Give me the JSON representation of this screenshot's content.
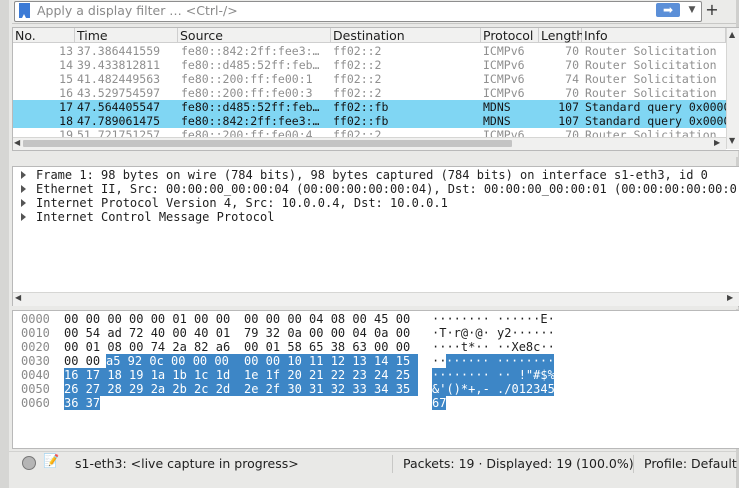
{
  "filter_bar": {
    "placeholder": "Apply a display filter … <Ctrl-/>",
    "apply_icon": "arrow-right-icon",
    "dropdown_icon": "chevron-down-icon",
    "add_button": "+"
  },
  "packet_list": {
    "columns": [
      "No.",
      "Time",
      "Source",
      "Destination",
      "Protocol",
      "Length",
      "Info"
    ],
    "rows": [
      {
        "no": "13",
        "time": "37.386441559",
        "source": "fe80::842:2ff:fee3:…",
        "destination": "ff02::2",
        "protocol": "ICMPv6",
        "length": "70",
        "info": "Router Solicitation",
        "selected": false
      },
      {
        "no": "14",
        "time": "39.433812811",
        "source": "fe80::d485:52ff:feb…",
        "destination": "ff02::2",
        "protocol": "ICMPv6",
        "length": "70",
        "info": "Router Solicitation",
        "selected": false
      },
      {
        "no": "15",
        "time": "41.482449563",
        "source": "fe80::200:ff:fe00:1",
        "destination": "ff02::2",
        "protocol": "ICMPv6",
        "length": "74",
        "info": "Router Solicitation",
        "selected": false
      },
      {
        "no": "16",
        "time": "43.529754597",
        "source": "fe80::200:ff:fe00:3",
        "destination": "ff02::2",
        "protocol": "ICMPv6",
        "length": "70",
        "info": "Router Solicitation",
        "selected": false
      },
      {
        "no": "17",
        "time": "47.564405547",
        "source": "fe80::d485:52ff:feb…",
        "destination": "ff02::fb",
        "protocol": "MDNS",
        "length": "107",
        "info": "Standard query 0x0000",
        "selected": true
      },
      {
        "no": "18",
        "time": "47.789061475",
        "source": "fe80::842:2ff:fee3:…",
        "destination": "ff02::fb",
        "protocol": "MDNS",
        "length": "107",
        "info": "Standard query 0x0000",
        "selected": true
      },
      {
        "no": "19",
        "time": "51.721751257",
        "source": "fe80::200:ff:fe00:4",
        "destination": "ff02::2",
        "protocol": "ICMPv6",
        "length": "70",
        "info": "Router Solicitation",
        "selected": false
      }
    ]
  },
  "details": {
    "lines": [
      "Frame 1: 98 bytes on wire (784 bits), 98 bytes captured (784 bits) on interface s1-eth3, id 0",
      "Ethernet II, Src: 00:00:00_00:00:04 (00:00:00:00:00:04), Dst: 00:00:00_00:00:01 (00:00:00:00:00:01)",
      "Internet Protocol Version 4, Src: 10.0.0.4, Dst: 10.0.0.1",
      "Internet Control Message Protocol"
    ]
  },
  "bytes": {
    "rows": [
      {
        "offset": "0000",
        "hex1": "00 00 00 00 00 01 00 00",
        "hex2": "00 00 00 04 08 00 45 00",
        "ascii": "········ ······E·"
      },
      {
        "offset": "0010",
        "hex1": "00 54 ad 72 40 00 40 01",
        "hex2": "79 32 0a 00 00 04 0a 00",
        "ascii": "·T·r@·@· y2······"
      },
      {
        "offset": "0020",
        "hex1": "00 01 08 00 74 2a 82 a6",
        "hex2": "00 01 58 65 38 63 00 00",
        "ascii": "····t*·· ··Xe8c··"
      },
      {
        "offset": "0030",
        "hex1_plain": "00 00",
        "hex1_hl": "a5 92 0c 00 00 00",
        "hex2": "00 00 10 11 12 13 14 15",
        "ascii_plain": "··",
        "ascii_hl": "······ ········"
      },
      {
        "offset": "0040",
        "hex1": "16 17 18 19 1a 1b 1c 1d",
        "hex2": "1e 1f 20 21 22 23 24 25",
        "ascii": "········ ·· !\"#$%"
      },
      {
        "offset": "0050",
        "hex1": "26 27 28 29 2a 2b 2c 2d",
        "hex2": "2e 2f 30 31 32 33 34 35",
        "ascii": "&'()*+,- ./012345"
      },
      {
        "offset": "0060",
        "hex1": "36 37",
        "hex2": "",
        "ascii": "67"
      }
    ]
  },
  "status_bar": {
    "capture_icon": "capture-status-icon",
    "edit_icon": "edit-comment-icon",
    "capture_text": "s1-eth3: <live capture in progress>",
    "packets_text": "Packets: 19 · Displayed: 19 (100.0%)",
    "profile_text": "Profile: Default"
  },
  "colors": {
    "selected_row": "#80d6f3",
    "byte_highlight": "#3d86c6",
    "apply_button": "#5b8fd8"
  }
}
